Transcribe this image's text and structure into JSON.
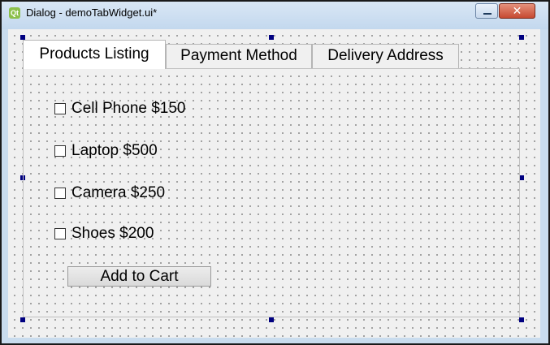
{
  "window": {
    "title": "Dialog - demoTabWidget.ui*",
    "app_icon_label": "Qt",
    "close_glyph": "✕"
  },
  "tabs": [
    {
      "label": "Products Listing",
      "active": true
    },
    {
      "label": "Payment Method",
      "active": false
    },
    {
      "label": "Delivery Address",
      "active": false
    }
  ],
  "products": [
    {
      "label": "Cell Phone $150",
      "checked": false
    },
    {
      "label": "Laptop $500",
      "checked": false
    },
    {
      "label": "Camera $250",
      "checked": false
    },
    {
      "label": "Shoes $200",
      "checked": false
    }
  ],
  "add_button": {
    "label": "Add to Cart"
  },
  "colors": {
    "selection_handle": "#000080",
    "grid_dot": "#8c8c8c",
    "background": "#f0f0f0"
  }
}
